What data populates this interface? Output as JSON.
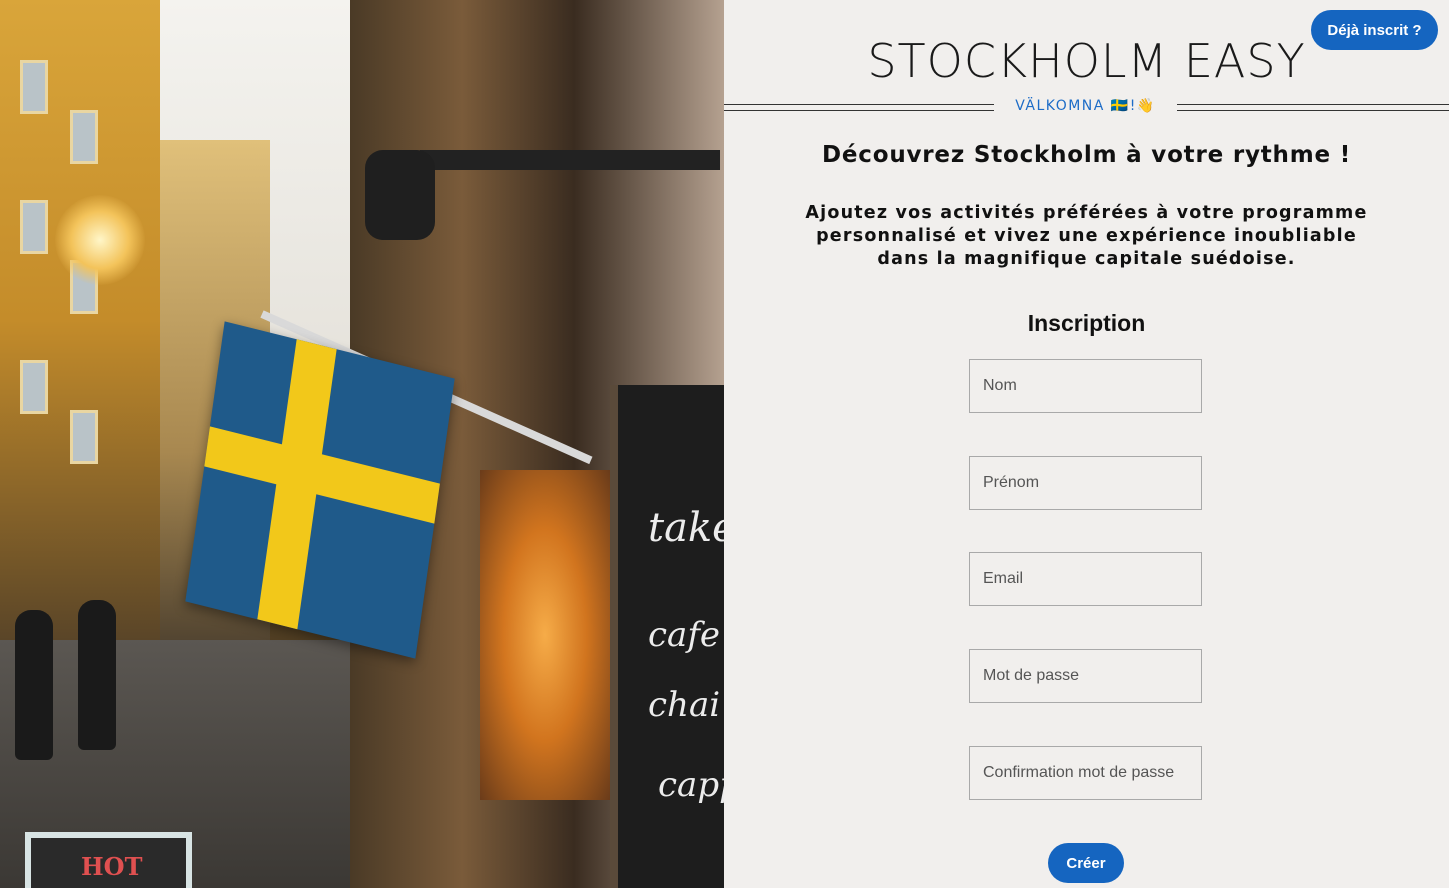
{
  "brand": {
    "title": "STOCKHOLM EASY",
    "welcome": "VÄLKOMNA 🇸🇪!👋"
  },
  "header": {
    "login_button": "Déjà inscrit ?"
  },
  "hero": {
    "headline": "Découvrez Stockholm à votre rythme !",
    "intro": "Ajoutez vos activités préférées à votre programme personnalisé et vivez une expérience inoubliable dans la magnifique capitale suédoise."
  },
  "signup": {
    "title": "Inscription",
    "fields": {
      "nom": {
        "placeholder": "Nom",
        "value": ""
      },
      "prenom": {
        "placeholder": "Prénom",
        "value": ""
      },
      "email": {
        "placeholder": "Email",
        "value": ""
      },
      "password": {
        "placeholder": "Mot de passe",
        "value": ""
      },
      "confirm": {
        "placeholder": "Confirmation mot de passe",
        "value": ""
      }
    },
    "submit_label": "Créer"
  },
  "photo": {
    "board_words": [
      "take",
      "cafe",
      "chai",
      "cappu"
    ],
    "sign_text": "HOT"
  },
  "colors": {
    "accent": "#1565c0",
    "background": "#f1efed",
    "flag_blue": "#1f5a8a",
    "flag_yellow": "#f2c81a"
  }
}
